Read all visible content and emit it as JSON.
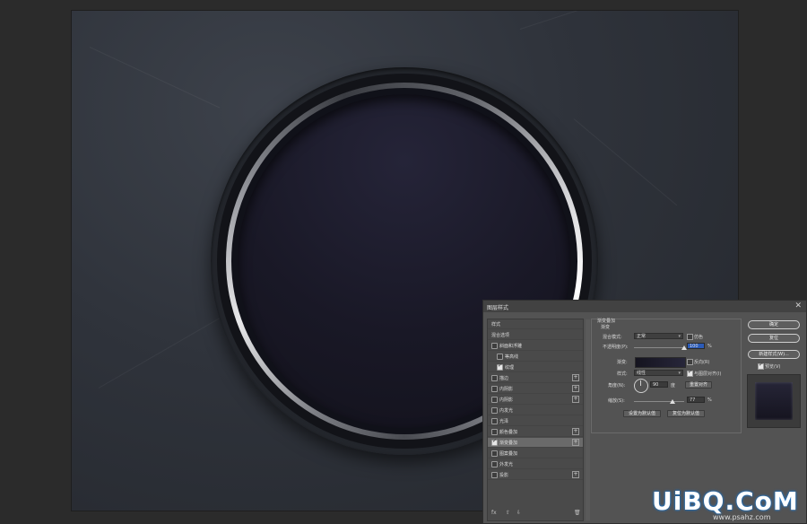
{
  "dialog": {
    "title": "图层样式",
    "close": "✕",
    "style_list": [
      {
        "label": "样式",
        "check": "none",
        "selected": false,
        "plus": false,
        "indent": false
      },
      {
        "label": "混合选项",
        "check": "none",
        "selected": false,
        "plus": false,
        "indent": false
      },
      {
        "label": "斜面和浮雕",
        "check": "off",
        "selected": false,
        "plus": false,
        "indent": false
      },
      {
        "label": "等高线",
        "check": "off",
        "selected": false,
        "plus": false,
        "indent": true
      },
      {
        "label": "纹理",
        "check": "on",
        "selected": false,
        "plus": false,
        "indent": true
      },
      {
        "label": "描边",
        "check": "off",
        "selected": false,
        "plus": true,
        "indent": false
      },
      {
        "label": "内阴影",
        "check": "off",
        "selected": false,
        "plus": true,
        "indent": false
      },
      {
        "label": "内阴影",
        "check": "off",
        "selected": false,
        "plus": true,
        "indent": false
      },
      {
        "label": "内发光",
        "check": "off",
        "selected": false,
        "plus": false,
        "indent": false
      },
      {
        "label": "光泽",
        "check": "off",
        "selected": false,
        "plus": false,
        "indent": false
      },
      {
        "label": "颜色叠加",
        "check": "off",
        "selected": false,
        "plus": true,
        "indent": false
      },
      {
        "label": "渐变叠加",
        "check": "on",
        "selected": true,
        "plus": true,
        "indent": false
      },
      {
        "label": "图案叠加",
        "check": "off",
        "selected": false,
        "plus": false,
        "indent": false
      },
      {
        "label": "外发光",
        "check": "off",
        "selected": false,
        "plus": false,
        "indent": false
      },
      {
        "label": "投影",
        "check": "off",
        "selected": false,
        "plus": true,
        "indent": false
      }
    ],
    "footer": {
      "fx": "fx",
      "up": "⇧",
      "down": "⇩",
      "trash": "🗑"
    },
    "settings": {
      "section_title": "渐变叠加",
      "subsection_title": "渐变",
      "blend_mode_label": "混合模式:",
      "blend_mode_value": "正常",
      "dither_label": "仿色",
      "opacity_label": "不透明度(P):",
      "opacity_value": "100",
      "percent": "%",
      "gradient_label": "渐变:",
      "reverse_label": "反向(R)",
      "style_label": "样式:",
      "style_value": "线性",
      "align_label": "与图层对齐(I)",
      "angle_label": "角度(N):",
      "angle_value": "90",
      "degree": "度",
      "reset_align": "重置对齐",
      "scale_label": "缩放(S):",
      "scale_value": "77",
      "set_default": "设置为默认值",
      "reset_default": "复位为默认值",
      "opacity_fraction": 1.0,
      "scale_fraction": 0.77
    },
    "buttons": {
      "ok": "确定",
      "cancel": "复位",
      "new_style": "新建样式(W)...",
      "preview": "预览(V)"
    }
  },
  "watermark": {
    "main": "UiBQ.CoM",
    "sub": "www.psahz.com"
  }
}
